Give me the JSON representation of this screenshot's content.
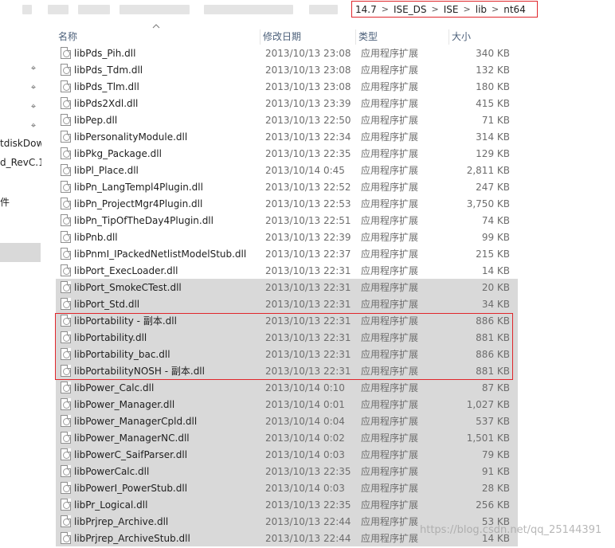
{
  "breadcrumb": [
    "14.7",
    "ISE_DS",
    "ISE",
    "lib",
    "nt64"
  ],
  "sidebar": {
    "items": [
      "tdiskDow",
      "d_RevC.1",
      "件"
    ]
  },
  "columns": {
    "name": "名称",
    "date": "修改日期",
    "type": "类型",
    "size": "大小"
  },
  "files": [
    {
      "name": "libPds_Pih.dll",
      "date": "2013/10/13 23:08",
      "type": "应用程序扩展",
      "size": "340 KB",
      "selected": false
    },
    {
      "name": "libPds_Tdm.dll",
      "date": "2013/10/13 23:08",
      "type": "应用程序扩展",
      "size": "132 KB",
      "selected": false
    },
    {
      "name": "libPds_Tlm.dll",
      "date": "2013/10/13 23:08",
      "type": "应用程序扩展",
      "size": "180 KB",
      "selected": false
    },
    {
      "name": "libPds2Xdl.dll",
      "date": "2013/10/13 23:39",
      "type": "应用程序扩展",
      "size": "415 KB",
      "selected": false
    },
    {
      "name": "libPep.dll",
      "date": "2013/10/13 22:50",
      "type": "应用程序扩展",
      "size": "71 KB",
      "selected": false
    },
    {
      "name": "libPersonalityModule.dll",
      "date": "2013/10/13 22:34",
      "type": "应用程序扩展",
      "size": "314 KB",
      "selected": false
    },
    {
      "name": "libPkg_Package.dll",
      "date": "2013/10/13 22:35",
      "type": "应用程序扩展",
      "size": "129 KB",
      "selected": false
    },
    {
      "name": "libPl_Place.dll",
      "date": "2013/10/14 0:45",
      "type": "应用程序扩展",
      "size": "2,811 KB",
      "selected": false
    },
    {
      "name": "libPn_LangTempl4Plugin.dll",
      "date": "2013/10/13 22:52",
      "type": "应用程序扩展",
      "size": "247 KB",
      "selected": false
    },
    {
      "name": "libPn_ProjectMgr4Plugin.dll",
      "date": "2013/10/13 22:53",
      "type": "应用程序扩展",
      "size": "3,750 KB",
      "selected": false
    },
    {
      "name": "libPn_TipOfTheDay4Plugin.dll",
      "date": "2013/10/13 22:51",
      "type": "应用程序扩展",
      "size": "74 KB",
      "selected": false
    },
    {
      "name": "libPnb.dll",
      "date": "2013/10/13 22:39",
      "type": "应用程序扩展",
      "size": "99 KB",
      "selected": false
    },
    {
      "name": "libPnmI_IPackedNetlistModelStub.dll",
      "date": "2013/10/13 22:37",
      "type": "应用程序扩展",
      "size": "215 KB",
      "selected": false
    },
    {
      "name": "libPort_ExecLoader.dll",
      "date": "2013/10/13 22:31",
      "type": "应用程序扩展",
      "size": "14 KB",
      "selected": false
    },
    {
      "name": "libPort_SmokeCTest.dll",
      "date": "2013/10/13 22:31",
      "type": "应用程序扩展",
      "size": "20 KB",
      "selected": true
    },
    {
      "name": "libPort_Std.dll",
      "date": "2013/10/13 22:31",
      "type": "应用程序扩展",
      "size": "34 KB",
      "selected": true
    },
    {
      "name": "libPortability - 副本.dll",
      "date": "2013/10/13 22:31",
      "type": "应用程序扩展",
      "size": "886 KB",
      "selected": true
    },
    {
      "name": "libPortability.dll",
      "date": "2013/10/13 22:31",
      "type": "应用程序扩展",
      "size": "881 KB",
      "selected": true
    },
    {
      "name": "libPortability_bac.dll",
      "date": "2013/10/13 22:31",
      "type": "应用程序扩展",
      "size": "886 KB",
      "selected": true
    },
    {
      "name": "libPortabilityNOSH - 副本.dll",
      "date": "2013/10/13 22:31",
      "type": "应用程序扩展",
      "size": "881 KB",
      "selected": true
    },
    {
      "name": "libPower_Calc.dll",
      "date": "2013/10/14 0:10",
      "type": "应用程序扩展",
      "size": "87 KB",
      "selected": true
    },
    {
      "name": "libPower_Manager.dll",
      "date": "2013/10/14 0:01",
      "type": "应用程序扩展",
      "size": "1,027 KB",
      "selected": true
    },
    {
      "name": "libPower_ManagerCpld.dll",
      "date": "2013/10/14 0:04",
      "type": "应用程序扩展",
      "size": "537 KB",
      "selected": true
    },
    {
      "name": "libPower_ManagerNC.dll",
      "date": "2013/10/14 0:02",
      "type": "应用程序扩展",
      "size": "1,501 KB",
      "selected": true
    },
    {
      "name": "libPowerC_SaifParser.dll",
      "date": "2013/10/14 0:03",
      "type": "应用程序扩展",
      "size": "79 KB",
      "selected": true
    },
    {
      "name": "libPowerCalc.dll",
      "date": "2013/10/13 22:35",
      "type": "应用程序扩展",
      "size": "91 KB",
      "selected": true
    },
    {
      "name": "libPowerI_PowerStub.dll",
      "date": "2013/10/14 0:03",
      "type": "应用程序扩展",
      "size": "28 KB",
      "selected": true
    },
    {
      "name": "libPr_Logical.dll",
      "date": "2013/10/13 22:35",
      "type": "应用程序扩展",
      "size": "256 KB",
      "selected": true
    },
    {
      "name": "libPrjrep_Archive.dll",
      "date": "2013/10/13 22:44",
      "type": "应用程序扩展",
      "size": "53 KB",
      "selected": true
    },
    {
      "name": "libPrjrep_ArchiveStub.dll",
      "date": "2013/10/13 22:44",
      "type": "应用程序扩展",
      "size": "14 KB",
      "selected": true
    }
  ],
  "watermark": "https://blog.csdn.net/qq_25144391",
  "colors": {
    "selection": "#d9d9d9",
    "annotation_red": "#e0262b",
    "header_text": "#4c607a"
  }
}
